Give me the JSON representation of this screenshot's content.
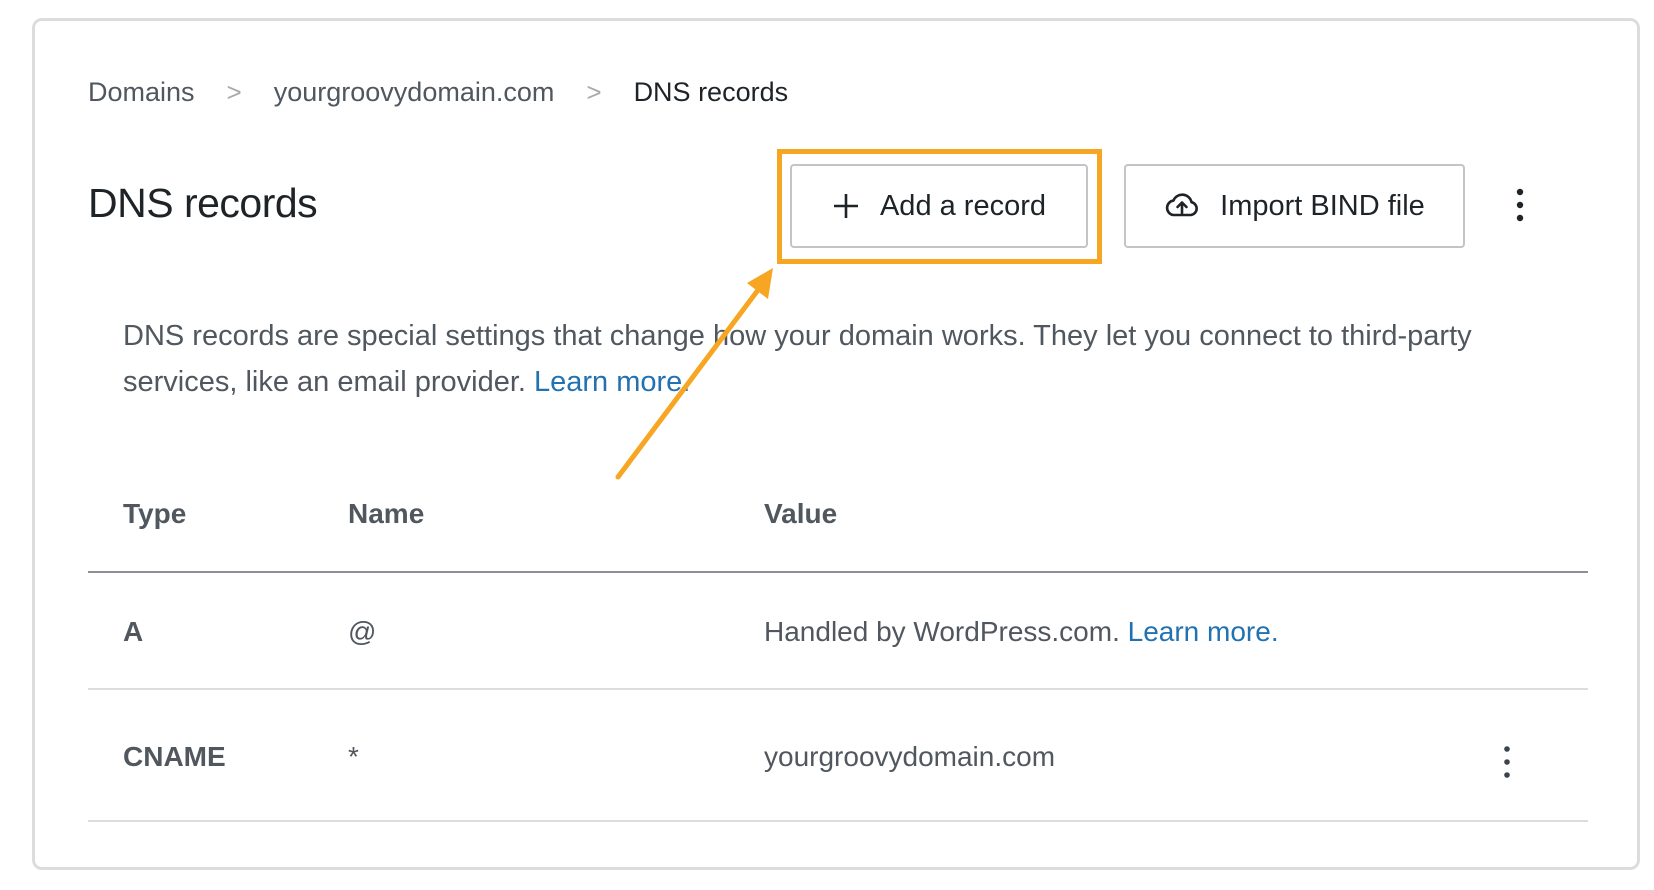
{
  "breadcrumb": {
    "items": [
      "Domains",
      "yourgroovydomain.com",
      "DNS records"
    ],
    "separator": ">"
  },
  "header": {
    "title": "DNS records",
    "add_record_label": "Add a record",
    "import_bind_label": "Import BIND file"
  },
  "description": {
    "text": "DNS records are special settings that change how your domain works. They let you connect to third-party services, like an email provider. ",
    "link": "Learn more."
  },
  "table": {
    "columns": [
      "Type",
      "Name",
      "Value"
    ],
    "rows": [
      {
        "type": "A",
        "name": "@",
        "value": "Handled by WordPress.com. ",
        "value_link": "Learn more."
      },
      {
        "type": "CNAME",
        "name": "*",
        "value": "yourgroovydomain.com"
      }
    ]
  },
  "colors": {
    "highlight": "#f6a623",
    "link": "#2271b1",
    "text_primary": "#1d2327",
    "text_secondary": "#50575e",
    "border": "#dcdcde"
  },
  "icons": {
    "add": "plus-icon",
    "import": "cloud-upload-icon",
    "more": "more-vertical-icon"
  }
}
